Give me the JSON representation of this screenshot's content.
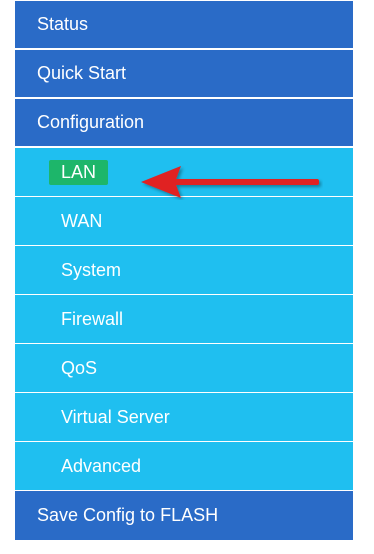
{
  "menu": {
    "items": [
      {
        "label": "Status"
      },
      {
        "label": "Quick Start"
      },
      {
        "label": "Configuration"
      },
      {
        "label": "LAN"
      },
      {
        "label": "WAN"
      },
      {
        "label": "System"
      },
      {
        "label": "Firewall"
      },
      {
        "label": "QoS"
      },
      {
        "label": "Virtual Server"
      },
      {
        "label": "Advanced"
      },
      {
        "label": "Save Config to FLASH"
      }
    ]
  },
  "colors": {
    "top_level_bg": "#2a6bc7",
    "submenu_bg": "#1fbff0",
    "selected_highlight": "#1db66a",
    "annotation_arrow": "#e02020"
  }
}
